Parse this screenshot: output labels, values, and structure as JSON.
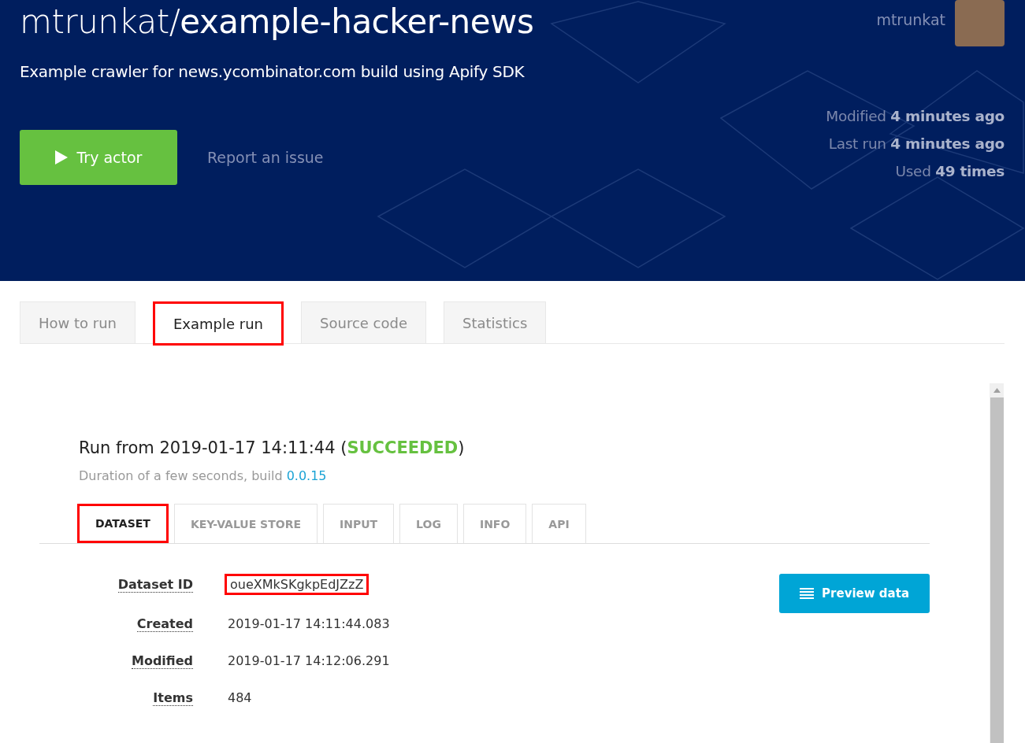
{
  "header": {
    "owner": "mtrunkat/",
    "name": "example-hacker-news",
    "description": "Example crawler for news.ycombinator.com build using Apify SDK",
    "username": "mtrunkat",
    "try_button": "Try actor",
    "report_link": "Report an issue",
    "stats": [
      "Modified **4 minutes ago**",
      "Last run **4 minutes ago**",
      "Used **49 times**"
    ]
  },
  "tabs": [
    {
      "label": "How to run",
      "selected": false,
      "highlighted": false
    },
    {
      "label": "Example run",
      "selected": true,
      "highlighted": true
    },
    {
      "label": "Source code",
      "selected": false,
      "highlighted": false
    },
    {
      "label": "Statistics",
      "selected": false,
      "highlighted": false
    }
  ],
  "run": {
    "title_prefix": "Run from 2019-01-17 14:11:44 (",
    "status": "SUCCEEDED",
    "title_suffix": ")",
    "duration": "Duration of a few seconds, build ",
    "build": "0.0.15",
    "subtabs": [
      {
        "label": "DATASET",
        "selected": true,
        "highlighted": true
      },
      {
        "label": "KEY-VALUE STORE",
        "selected": false,
        "highlighted": false
      },
      {
        "label": "INPUT",
        "selected": false,
        "highlighted": false
      },
      {
        "label": "LOG",
        "selected": false,
        "highlighted": false
      },
      {
        "label": "INFO",
        "selected": false,
        "highlighted": false
      },
      {
        "label": "API",
        "selected": false,
        "highlighted": false
      }
    ],
    "details": [
      {
        "label": "Dataset ID",
        "value": "oueXMkSKgkpEdJZzZ",
        "highlighted": true
      },
      {
        "label": "Created",
        "value": "2019-01-17 14:11:44.083",
        "highlighted": false
      },
      {
        "label": "Modified",
        "value": "2019-01-17 14:12:06.291",
        "highlighted": false
      },
      {
        "label": "Items",
        "value": "484",
        "highlighted": false
      }
    ],
    "preview_button": "Preview data"
  }
}
